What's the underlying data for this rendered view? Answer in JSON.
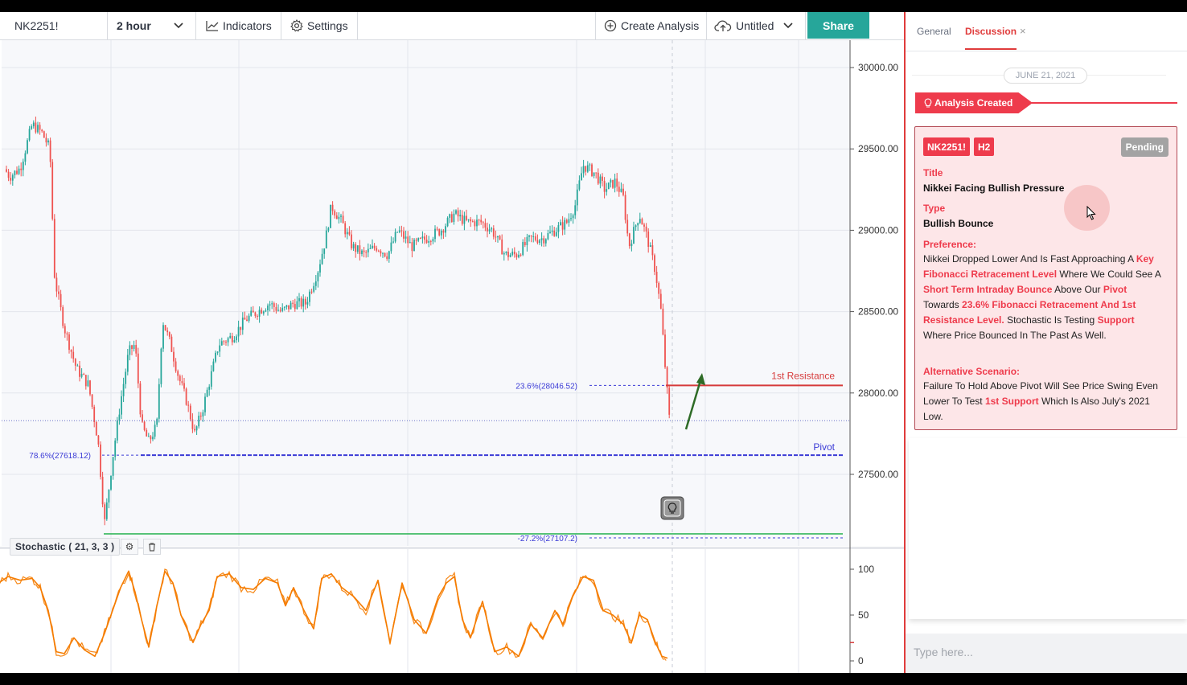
{
  "toolbar": {
    "symbol": "NK2251!",
    "interval": "2 hour",
    "indicators_label": "Indicators",
    "settings_label": "Settings",
    "create_label": "Create Analysis",
    "untitled_label": "Untitled",
    "share_label": "Share"
  },
  "study": {
    "label": "Stochastic ( 21, 3, 3 )"
  },
  "panel": {
    "tabs": [
      "General",
      "Discussion"
    ],
    "date": "JUNE 21, 2021",
    "badge": "Analysis Created",
    "card": {
      "symbol": "NK2251!",
      "timeframe": "H2",
      "status": "Pending",
      "title_label": "Title",
      "title": "Nikkei Facing Bullish Pressure",
      "type_label": "Type",
      "type": "Bullish Bounce",
      "preference_label": "Preference:",
      "preference_parts": [
        {
          "t": "Nikkei Dropped Lower And Is Fast Approaching A ",
          "h": false
        },
        {
          "t": "Key Fibonacci Retracement Level",
          "h": true
        },
        {
          "t": " Where We Could See A ",
          "h": false
        },
        {
          "t": "Short Term Intraday Bounce",
          "h": true
        },
        {
          "t": " Above Our ",
          "h": false
        },
        {
          "t": "Pivot",
          "h": true
        },
        {
          "t": " Towards ",
          "h": false
        },
        {
          "t": "23.6% Fibonacci Retracement And 1st Resistance Level.",
          "h": true
        },
        {
          "t": " Stochastic Is Testing ",
          "h": false
        },
        {
          "t": "Support",
          "h": true
        },
        {
          "t": " Where Price Bounced In The Past As Well.",
          "h": false
        }
      ],
      "alt_label": "Alternative Scenario:",
      "alt_parts": [
        {
          "t": "Failure To Hold Above Pivot Will See Price Swing Even Lower To Test ",
          "h": false
        },
        {
          "t": "1st Support",
          "h": true
        },
        {
          "t": " Which Is Also July's 2021 Low.",
          "h": false
        }
      ]
    },
    "input_placeholder": "Type here..."
  },
  "chart_data": [
    {
      "type": "candlestick",
      "y_ticks": [
        "30000.00",
        "29500.00",
        "29000.00",
        "28500.00",
        "28000.00",
        "27500.00"
      ],
      "ylim": [
        27100,
        30000
      ],
      "levels": [
        {
          "name": "1st Resistance",
          "value": 28046.52,
          "label": "23.6%(28046.52)",
          "color": "#d63a3a"
        },
        {
          "name": "Pivot",
          "value": 27618.12,
          "label": "78.6%(27618.12)",
          "color": "#3b3bd6"
        },
        {
          "name": "",
          "value": 27107.2,
          "label": "-27.2%(27107.2)",
          "color": "#3b3bd6"
        }
      ],
      "support_line_color": "#22b14c",
      "up_color": "#26a69a",
      "down_color": "#ef5350",
      "path": [
        [
          0,
          29420
        ],
        [
          12,
          29330
        ],
        [
          25,
          29380
        ],
        [
          40,
          29650
        ],
        [
          52,
          29600
        ],
        [
          62,
          29500
        ],
        [
          68,
          28700
        ],
        [
          80,
          28400
        ],
        [
          95,
          28150
        ],
        [
          110,
          28050
        ],
        [
          122,
          27700
        ],
        [
          130,
          27200
        ],
        [
          140,
          27600
        ],
        [
          150,
          27950
        ],
        [
          160,
          28250
        ],
        [
          168,
          28300
        ],
        [
          176,
          27800
        ],
        [
          185,
          27700
        ],
        [
          195,
          27800
        ],
        [
          202,
          28450
        ],
        [
          212,
          28300
        ],
        [
          222,
          28100
        ],
        [
          232,
          27950
        ],
        [
          242,
          27750
        ],
        [
          252,
          27900
        ],
        [
          262,
          28100
        ],
        [
          272,
          28300
        ],
        [
          290,
          28350
        ],
        [
          305,
          28450
        ],
        [
          320,
          28500
        ],
        [
          335,
          28550
        ],
        [
          350,
          28500
        ],
        [
          365,
          28550
        ],
        [
          380,
          28550
        ],
        [
          395,
          28750
        ],
        [
          405,
          28950
        ],
        [
          412,
          29150
        ],
        [
          425,
          29050
        ],
        [
          438,
          28900
        ],
        [
          452,
          28850
        ],
        [
          468,
          28900
        ],
        [
          482,
          28850
        ],
        [
          495,
          29000
        ],
        [
          512,
          28900
        ],
        [
          530,
          28950
        ],
        [
          548,
          29000
        ],
        [
          565,
          29100
        ],
        [
          580,
          29050
        ],
        [
          598,
          29050
        ],
        [
          612,
          29000
        ],
        [
          628,
          28850
        ],
        [
          642,
          28850
        ],
        [
          660,
          28950
        ],
        [
          675,
          28950
        ],
        [
          690,
          29000
        ],
        [
          705,
          29050
        ],
        [
          715,
          29150
        ],
        [
          725,
          29400
        ],
        [
          740,
          29350
        ],
        [
          752,
          29250
        ],
        [
          765,
          29300
        ],
        [
          775,
          29200
        ],
        [
          782,
          28900
        ],
        [
          795,
          29100
        ],
        [
          805,
          28950
        ],
        [
          815,
          28750
        ],
        [
          822,
          28500
        ],
        [
          828,
          28100
        ],
        [
          833,
          27800
        ]
      ]
    },
    {
      "type": "line",
      "name": "Stochastic",
      "y_ticks": [
        "100",
        "50",
        "0"
      ],
      "ylim": [
        0,
        100
      ],
      "color": "#f57c00",
      "x": [
        0,
        10,
        25,
        40,
        50,
        60,
        70,
        80,
        92,
        105,
        118,
        130,
        140,
        150,
        160,
        168,
        176,
        185,
        195,
        205,
        215,
        225,
        240,
        250,
        260,
        270,
        285,
        300,
        315,
        330,
        345,
        355,
        365,
        378,
        390,
        400,
        412,
        425,
        440,
        455,
        470,
        485,
        500,
        515,
        530,
        545,
        555,
        565,
        575,
        585,
        600,
        615,
        630,
        645,
        660,
        675,
        690,
        700,
        712,
        725,
        738,
        750,
        762,
        775,
        785,
        795,
        805,
        815,
        823,
        830
      ],
      "values": [
        86,
        92,
        88,
        90,
        80,
        55,
        10,
        8,
        25,
        12,
        5,
        30,
        55,
        80,
        98,
        75,
        45,
        15,
        60,
        98,
        85,
        50,
        20,
        40,
        55,
        92,
        95,
        80,
        78,
        90,
        85,
        60,
        80,
        55,
        35,
        90,
        95,
        80,
        70,
        55,
        88,
        20,
        85,
        45,
        30,
        70,
        85,
        92,
        45,
        25,
        65,
        10,
        15,
        5,
        40,
        25,
        55,
        40,
        70,
        92,
        88,
        55,
        50,
        40,
        20,
        50,
        45,
        20,
        5,
        3
      ]
    }
  ]
}
